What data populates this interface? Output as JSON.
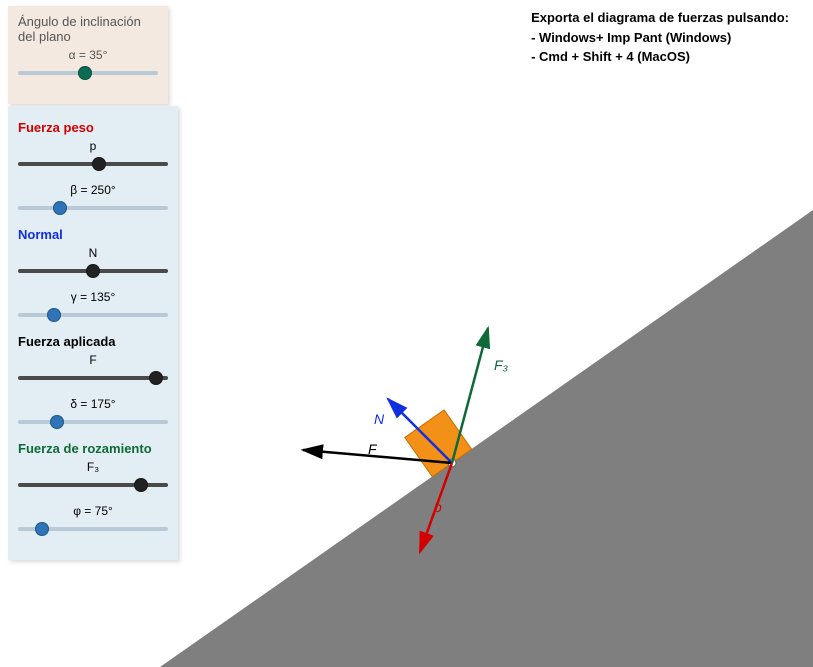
{
  "anglePanel": {
    "title1": "Ángulo de inclinación",
    "title2": "del plano",
    "value_label": "α = 35°",
    "value_pct": 48
  },
  "forces": {
    "peso": {
      "heading": "Fuerza peso",
      "mag_label": "p",
      "mag_pct": 54,
      "ang_label": "β = 250°",
      "ang_pct": 28
    },
    "normal": {
      "heading": "Normal",
      "mag_label": "N",
      "mag_pct": 50,
      "ang_label": "γ = 135°",
      "ang_pct": 24
    },
    "aplicada": {
      "heading": "Fuerza aplicada",
      "mag_label": "F",
      "mag_pct": 92,
      "ang_label": "δ = 175°",
      "ang_pct": 26
    },
    "roz": {
      "heading": "Fuerza de rozamiento",
      "mag_label": "F₃",
      "mag_pct": 82,
      "ang_label": "φ = 75°",
      "ang_pct": 16
    }
  },
  "export": {
    "line1": "Exporta el diagrama de fuerzas pulsando:",
    "line2": "- Windows+ Imp Pant (Windows)",
    "line3": "- Cmd + Shift + 4 (MacOS)"
  },
  "diagram": {
    "labels": {
      "N": "N",
      "F": "F",
      "F3": "F₃",
      "P": "p"
    }
  },
  "chart_data": {
    "type": "diagram",
    "description": "Free-body diagram of a block on an inclined plane with weight, normal, applied force, and friction vectors.",
    "incline_angle_deg": 35,
    "block": {
      "on_incline": true,
      "color": "#f39018"
    },
    "vectors": [
      {
        "name": "Peso (weight)",
        "symbol": "p",
        "angle_deg": 250,
        "color": "#d40000"
      },
      {
        "name": "Normal",
        "symbol": "N",
        "angle_deg": 135,
        "color": "#1030e0"
      },
      {
        "name": "Fuerza aplicada",
        "symbol": "F",
        "angle_deg": 175,
        "color": "#000000"
      },
      {
        "name": "Fuerza de rozamiento",
        "symbol": "F₃",
        "angle_deg": 75,
        "color": "#0e6a36"
      }
    ],
    "slider_ranges_note": "magnitude sliders shown as relative positions only; absolute magnitudes not displayed"
  }
}
